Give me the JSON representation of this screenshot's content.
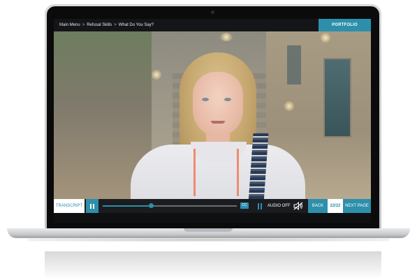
{
  "breadcrumb": {
    "items": [
      "Main Menu",
      "Refusal Skills",
      "What Do You Say?"
    ],
    "separator": ">"
  },
  "header": {
    "portfolio_label": "PORTFOLIO"
  },
  "video": {
    "subject": "video-frame",
    "progress": 0.36
  },
  "controls": {
    "transcript_label": "TRANSCRIPT",
    "play_icon": "pause-icon",
    "cc_label": "CC",
    "audio_label": "AUDIO OFF",
    "audio_icon": "audio-off-icon",
    "back_label": "BACK",
    "page_count": "22/22",
    "next_label": "NEXT PAGE"
  },
  "colors": {
    "accent": "#2d8fab",
    "bar": "#1b1c20",
    "topbar": "#141518"
  }
}
